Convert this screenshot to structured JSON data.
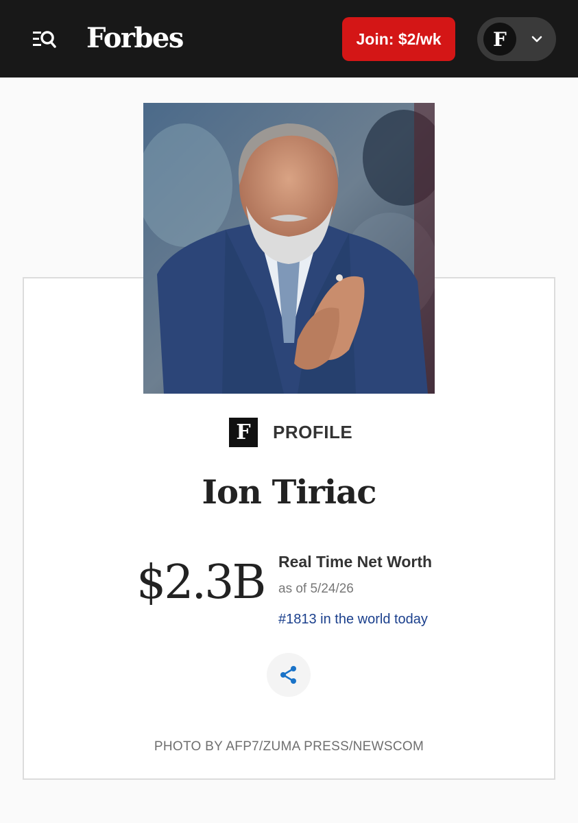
{
  "header": {
    "logo_text": "Forbes",
    "join_label": "Join: $2/wk",
    "account_initial": "F",
    "icons": {
      "menu": "search-menu-icon",
      "dropdown": "chevron-down-icon"
    },
    "colors": {
      "bar": "#181818",
      "join": "#d41616"
    }
  },
  "profile": {
    "badge_letter": "F",
    "section_label": "PROFILE",
    "name": "Ion Tiriac",
    "net_worth": "$2.3B",
    "net_worth_title": "Real Time Net Worth",
    "as_of": "as of 5/24/26",
    "rank_text": "#1813 in the world today",
    "share_icon": "share-icon",
    "photo_credit": "PHOTO BY AFP7/ZUMA PRESS/NEWSCOM",
    "colors": {
      "rank_link": "#1a3f8c",
      "share": "#1a73c8"
    }
  }
}
